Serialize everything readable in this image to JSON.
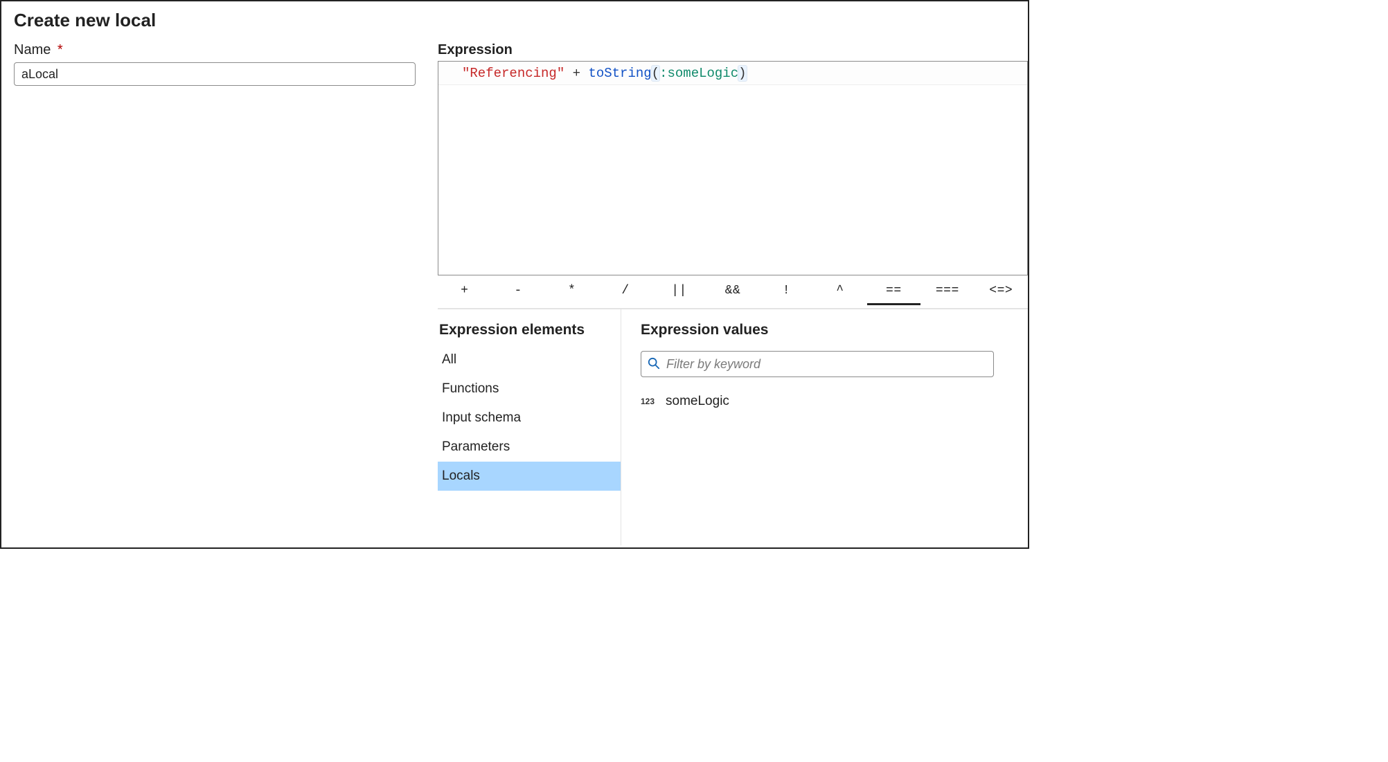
{
  "header": {
    "title": "Create new local"
  },
  "name_field": {
    "label": "Name",
    "required_mark": "*",
    "value": "aLocal"
  },
  "expression": {
    "label": "Expression",
    "tokens": {
      "string_lit": "\"Referencing\"",
      "sp1": " ",
      "plus": "+",
      "sp2": " ",
      "func": "toString",
      "lparen": "(",
      "param_prefix": ":",
      "param_name": "someLogic",
      "rparen": ")"
    }
  },
  "operator_bar": {
    "items": [
      {
        "key": "plus",
        "label": "+"
      },
      {
        "key": "minus",
        "label": "-"
      },
      {
        "key": "mult",
        "label": "*"
      },
      {
        "key": "div",
        "label": "/"
      },
      {
        "key": "or",
        "label": "||"
      },
      {
        "key": "and",
        "label": "&&"
      },
      {
        "key": "not",
        "label": "!"
      },
      {
        "key": "xor",
        "label": "^"
      },
      {
        "key": "eq",
        "label": "==",
        "active": true
      },
      {
        "key": "seq",
        "label": "==="
      },
      {
        "key": "cmp",
        "label": "<=>"
      }
    ]
  },
  "elements_panel": {
    "heading": "Expression elements",
    "items": [
      {
        "key": "all",
        "label": "All"
      },
      {
        "key": "functions",
        "label": "Functions"
      },
      {
        "key": "input_schema",
        "label": "Input schema"
      },
      {
        "key": "parameters",
        "label": "Parameters"
      },
      {
        "key": "locals",
        "label": "Locals",
        "selected": true
      }
    ]
  },
  "values_panel": {
    "heading": "Expression values",
    "filter_placeholder": "Filter by keyword",
    "items": [
      {
        "type_badge": "123",
        "label": "someLogic"
      }
    ]
  }
}
